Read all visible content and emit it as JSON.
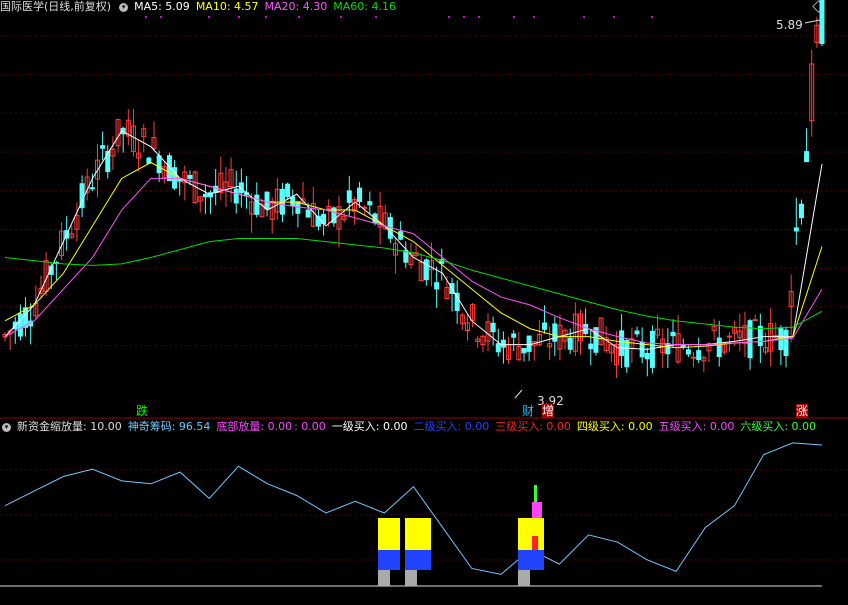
{
  "title": "国际医学(日线,前复权)",
  "ma": [
    {
      "label": "MA5: 5.09",
      "color": "#ffffff"
    },
    {
      "label": "MA10: 4.57",
      "color": "#ffff00"
    },
    {
      "label": "MA20: 4.30",
      "color": "#ff55ff"
    },
    {
      "label": "MA60: 4.16",
      "color": "#00dd00"
    }
  ],
  "price_high_label": "5.89",
  "price_low_label": "3.92",
  "markers": {
    "die": "跌",
    "cai": "财",
    "zeng": "增",
    "zhang": "涨"
  },
  "indicator": {
    "name": "新资金缩放量",
    "items": [
      {
        "label": ": 10.00",
        "color": "#dddddd"
      },
      {
        "label": "神奇筹码: 96.54",
        "color": "#6fc8ff"
      },
      {
        "label": "底部放量: 0.00",
        "color": "#ff44ff"
      },
      {
        "label": ": 0.00",
        "color": "#ff44ff"
      },
      {
        "label": "一级买入: 0.00",
        "color": "#ffffff"
      },
      {
        "label": "二级买入: 0.00",
        "color": "#2244ff"
      },
      {
        "label": "三级买入: 0.00",
        "color": "#ff2222"
      },
      {
        "label": "四级买入: 0.00",
        "color": "#ffff00"
      },
      {
        "label": "五级买入: 0.00",
        "color": "#ff44ff"
      },
      {
        "label": "六级买入: 0.00",
        "color": "#33ff33"
      }
    ]
  },
  "chart_data": [
    {
      "type": "candlestick",
      "title": "国际医学(日线,前复权)",
      "series": [
        {
          "name": "MA5",
          "values": [
            4.0,
            4.2,
            4.6,
            5.0,
            5.3,
            5.2,
            5.0,
            4.9,
            4.95,
            4.8,
            4.9,
            4.7,
            4.85,
            4.7,
            4.5,
            4.4,
            4.1,
            3.95,
            3.95,
            4.0,
            4.05,
            3.93,
            3.92,
            3.95,
            3.95,
            3.97,
            4.0,
            4.0,
            5.09
          ]
        },
        {
          "name": "MA10",
          "values": [
            4.1,
            4.2,
            4.4,
            4.7,
            5.0,
            5.1,
            5.0,
            4.95,
            4.9,
            4.85,
            4.85,
            4.8,
            4.8,
            4.7,
            4.6,
            4.45,
            4.3,
            4.15,
            4.05,
            4.0,
            4.0,
            3.97,
            3.95,
            3.93,
            3.94,
            3.96,
            3.97,
            4.0,
            4.57
          ]
        },
        {
          "name": "MA20",
          "values": [
            4.0,
            4.1,
            4.3,
            4.5,
            4.8,
            5.0,
            5.0,
            4.95,
            4.9,
            4.85,
            4.82,
            4.8,
            4.75,
            4.7,
            4.65,
            4.5,
            4.35,
            4.25,
            4.2,
            4.12,
            4.05,
            4.0,
            3.96,
            3.95,
            3.95,
            3.96,
            3.97,
            3.99,
            4.3
          ]
        },
        {
          "name": "MA60",
          "values": [
            4.5,
            4.48,
            4.46,
            4.45,
            4.46,
            4.5,
            4.55,
            4.6,
            4.62,
            4.62,
            4.62,
            4.6,
            4.58,
            4.56,
            4.53,
            4.48,
            4.42,
            4.37,
            4.32,
            4.27,
            4.22,
            4.17,
            4.13,
            4.1,
            4.08,
            4.06,
            4.05,
            4.06,
            4.16
          ]
        }
      ],
      "high": 5.89,
      "low": 3.92
    },
    {
      "type": "line",
      "title": "新资金缩放量",
      "series": [
        {
          "name": "神奇筹码",
          "values": [
            55,
            65,
            75,
            80,
            72,
            70,
            78,
            60,
            82,
            70,
            62,
            50,
            58,
            50,
            68,
            40,
            12,
            8,
            25,
            15,
            35,
            30,
            18,
            10,
            40,
            55,
            90,
            98,
            96.54
          ]
        }
      ]
    }
  ]
}
